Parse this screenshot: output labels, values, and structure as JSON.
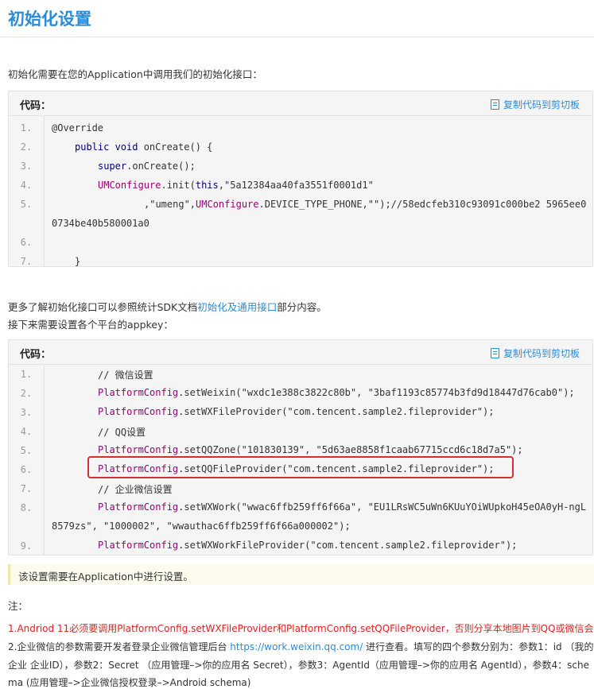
{
  "page_title": "初始化设置",
  "intro": "初始化需要在您的Application中调用我们的初始化接口：",
  "code_label": "代码：",
  "copy_label": "复制代码到剪切板",
  "code1": {
    "line_numbers": [
      "1.",
      "2.",
      "3.",
      "4.",
      "5.",
      "",
      "6.",
      "7."
    ],
    "l1": "@Override",
    "l2a": "public void ",
    "l2b": "onCreate() {",
    "l3a": "super",
    "l3b": ".onCreate();",
    "l4a": "UMConfigure",
    "l4b": ".init(",
    "l4c": "this",
    "l4d": ",\"5a12384aa40fa3551f0001d1\"",
    "l5a": ",\"umeng\",",
    "l5b": "UMConfigure",
    "l5c": ".DEVICE_TYPE_PHONE,\"\");//58edcfeb310c93091c000be2 5965ee0",
    "l5d": "0734be40b580001a0",
    "l7": "}"
  },
  "more_info_prefix": "更多了解初始化接口可以参照统计SDK文档",
  "more_info_link": "初始化及通用接口",
  "more_info_suffix": "部分内容。",
  "appkey_text": "接下来需要设置各个平台的appkey：",
  "code2": {
    "line_numbers": [
      "1.",
      "2.",
      "3.",
      "4.",
      "5.",
      "6.",
      "7.",
      "8.",
      "",
      "9."
    ],
    "c1": "// 微信设置",
    "cls": "PlatformConfig",
    "l2": ".setWeixin(\"wxdc1e388c3822c80b\", \"3baf1193c85774b3fd9d18447d76cab0\");",
    "l3": ".setWXFileProvider(\"com.tencent.sample2.fileprovider\");",
    "c4": "// QQ设置",
    "l5": ".setQQZone(\"101830139\", \"5d63ae8858f1caab67715ccd6c18d7a5\");",
    "l6": ".setQQFileProvider(\"com.tencent.sample2.fileprovider\");",
    "c7": "// 企业微信设置",
    "l8": ".setWXWork(\"wwac6ffb259ff6f66a\", \"EU1LRsWC5uWn6KUuYOiWUpkoH45eOA0yH-ngL",
    "l8b": "8579zs\", \"1000002\", \"wwauthac6ffb259ff6f66a000002\");",
    "l9": ".setWXWorkFileProvider(\"com.tencent.sample2.fileprovider\");"
  },
  "note_text": "该设置需要在Application中进行设置。",
  "zhu": "注：",
  "item1": "1.Andriod 11必须要调用PlatformConfig.setWXFileProvider和PlatformConfig.setQQFileProvider，否则分享本地图片到QQ或微信会失败",
  "item2a": "2.企业微信的参数需要开发者登录企业微信管理后台 ",
  "item2_link": "https://work.weixin.qq.com/",
  "item2b": " 进行查看。填写的四个参数分别为：参数1：id （我的",
  "item2c": "企业 企业ID），参数2：Secret （应用管理–>你的应用名 Secret），参数3：AgentId（应用管理–>你的应用名 AgentId），参数4：sche",
  "item2d": "ma (应用管理–>企业微信授权登录–>Android schema)"
}
